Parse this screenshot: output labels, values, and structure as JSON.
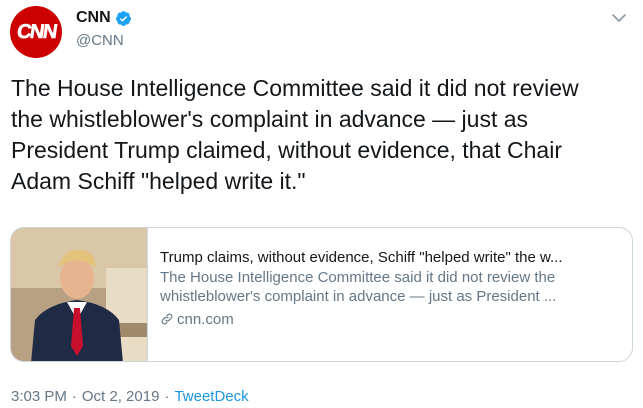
{
  "author": {
    "logo_text": "CNN",
    "name": "CNN",
    "handle": "@CNN"
  },
  "tweet": {
    "text": "The House Intelligence Committee said it did not review\nthe whistleblower's complaint in advance — just as\nPresident Trump claimed, without evidence, that Chair\nAdam Schiff \"helped write it.\""
  },
  "card": {
    "title": "Trump claims, without evidence, Schiff \"helped write\" the w...",
    "description_line1": "The House Intelligence Committee said it did not review the",
    "description_line2": "whistleblower's complaint in advance — just as President ...",
    "domain": "cnn.com"
  },
  "meta": {
    "time": "3:03 PM",
    "separator": "·",
    "date": "Oct 2, 2019",
    "separator2": "·",
    "source": "TweetDeck"
  },
  "colors": {
    "brand_red": "#cc0000",
    "verified_blue": "#1da1f2",
    "link_blue": "#1b95e0",
    "secondary_text": "#657786"
  },
  "icons": [
    "cnn-logo",
    "verified-badge-icon",
    "chevron-down-icon",
    "link-icon"
  ]
}
